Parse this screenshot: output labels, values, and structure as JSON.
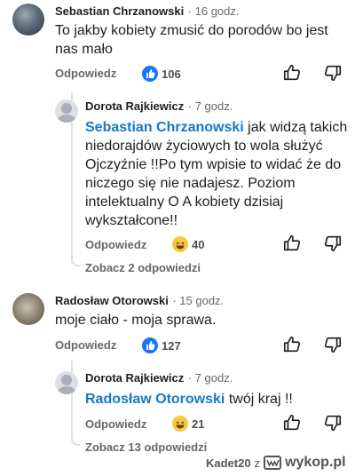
{
  "comments": [
    {
      "author": "Sebastian Chrzanowski",
      "time": "16 godz.",
      "text": "To jakby kobiety zmusić do porodów bo jest nas mało",
      "reply_label": "Odpowiedz",
      "reaction_count": "106",
      "reaction_icon": "thumbs-up-icon"
    },
    {
      "author": "Dorota Rajkiewicz",
      "time": "7 godz.",
      "mention": "Sebastian Chrzanowski",
      "text": "jak widzą takich niedorajdów  życiowych to wola służyć Ojczyźnie !!Po tym wpisie to widać że do niczego się nie nadajesz. Poziom intelektualny O A kobiety dzisiaj wykształcone!!",
      "reply_label": "Odpowiedz",
      "reaction_count": "40",
      "reaction_icon": "laughing-emoji-icon",
      "view_replies": "Zobacz 2 odpowiedzi"
    },
    {
      "author": "Radosław Otorowski",
      "time": "15 godz.",
      "text": "moje ciało - moja sprawa.",
      "reply_label": "Odpowiedz",
      "reaction_count": "127",
      "reaction_icon": "thumbs-up-icon"
    },
    {
      "author": "Dorota Rajkiewicz",
      "time": "7 godz.",
      "mention": "Radosław Otorowski",
      "text": "twój kraj !!",
      "reply_label": "Odpowiedz",
      "reaction_count": "21",
      "reaction_icon": "laughing-emoji-icon",
      "view_replies": "Zobacz 13 odpowiedzi"
    }
  ],
  "watermark": {
    "user": "Kadet20",
    "joiner": "z",
    "site": "wykop.pl"
  },
  "colors": {
    "mention": "#1877c8",
    "like": "#1877f2"
  }
}
